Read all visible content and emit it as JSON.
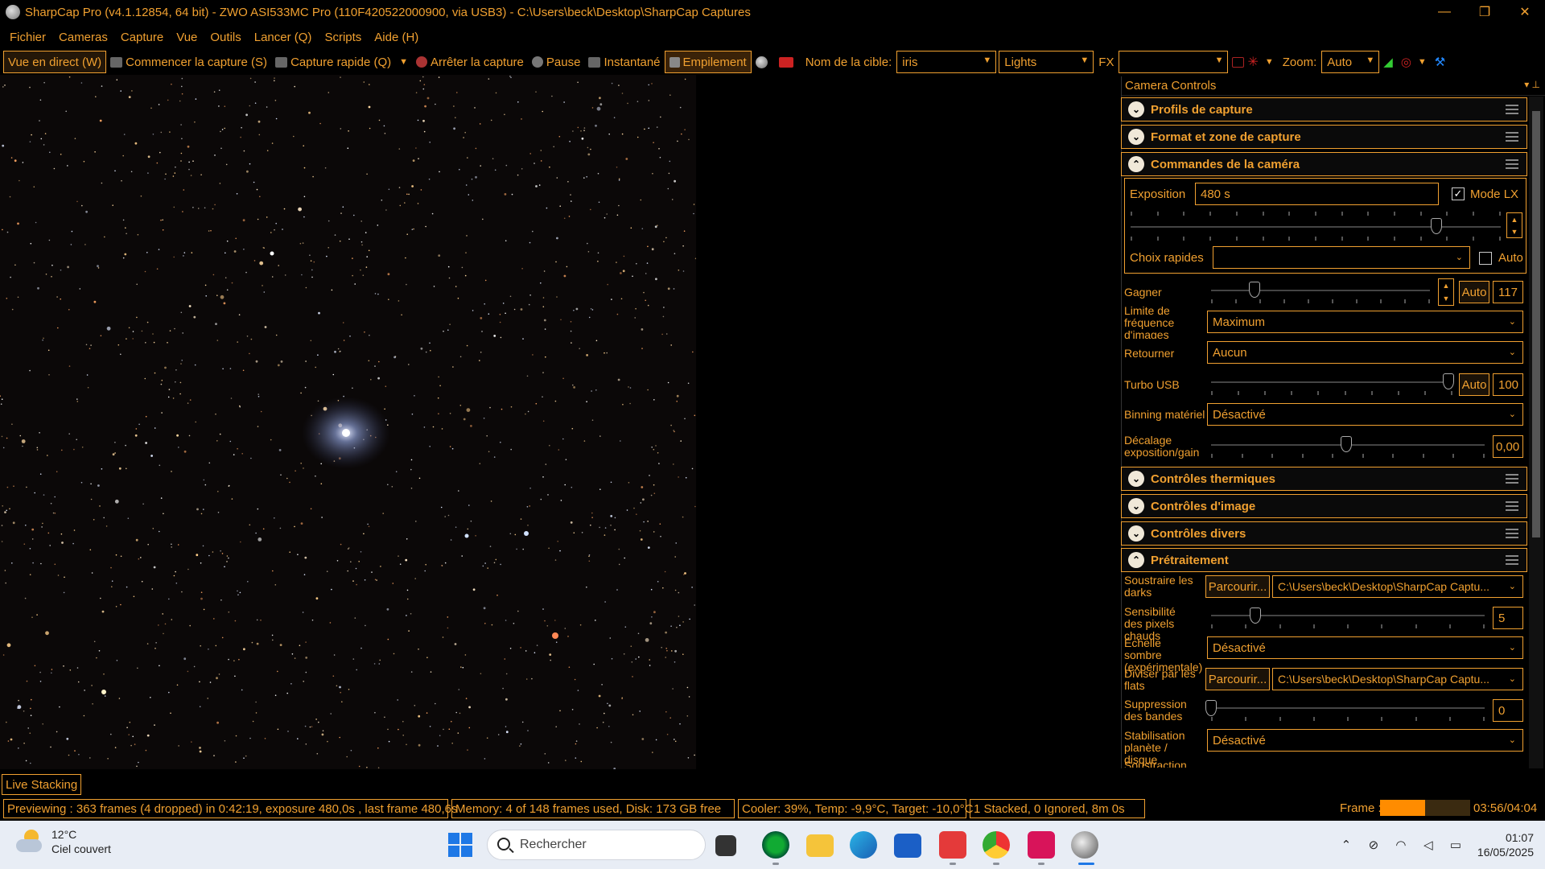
{
  "window": {
    "title": "SharpCap Pro (v4.1.12854, 64 bit) - ZWO ASI533MC Pro (110F420522000900, via USB3) - C:\\Users\\beck\\Desktop\\SharpCap Captures",
    "minimize": "—",
    "maximize": "❐",
    "close": "✕"
  },
  "menu": [
    "Fichier",
    "Cameras",
    "Capture",
    "Vue",
    "Outils",
    "Lancer (Q)",
    "Scripts",
    "Aide (H)"
  ],
  "toolbar": {
    "live_view": "Vue en direct (W)",
    "start_capture": "Commencer la capture (S)",
    "quick_capture": "Capture rapide (Q)",
    "stop_capture": "Arrêter la capture",
    "pause": "Pause",
    "snapshot": "Instantané",
    "stacking": "Empilement",
    "target_label": "Nom de la cible:",
    "target_value": "iris",
    "frame_type": "Lights",
    "fx_label": "FX",
    "fx_value": "",
    "zoom_label": "Zoom:",
    "zoom_value": "Auto"
  },
  "panel": {
    "header": "Camera Controls",
    "sections": {
      "profiles": "Profils de capture",
      "format": "Format et zone de capture",
      "camera": "Commandes de la caméra",
      "thermal": "Contrôles thermiques",
      "image": "Contrôles d'image",
      "misc": "Contrôles divers",
      "preprocessing": "Prétraitement"
    },
    "exposure_label": "Exposition",
    "exposure_value": "480 s",
    "lx_mode_label": "Mode LX",
    "lx_mode_checked": true,
    "quick_choices_label": "Choix rapides",
    "quick_choices_value": "",
    "quick_auto_label": "Auto",
    "gain_label": "Gagner",
    "gain_auto": "Auto",
    "gain_value": "117",
    "fps_limit_label": "Limite de fréquence d'images",
    "fps_limit_value": "Maximum",
    "flip_label": "Retourner",
    "flip_value": "Aucun",
    "usb_turbo_label": "Turbo USB",
    "usb_turbo_auto": "Auto",
    "usb_turbo_value": "100",
    "hw_binning_label": "Binning matériel",
    "hw_binning_value": "Désactivé",
    "exp_gain_offset_label": "Décalage exposition/gain",
    "exp_gain_offset_value": "0,00",
    "subtract_darks_label": "Soustraire les darks",
    "browse_label": "Parcourir...",
    "darks_path": "C:\\Users\\beck\\Desktop\\SharpCap Captu...",
    "hot_pixel_label": "Sensibilité des pixels chauds",
    "hot_pixel_value": "5",
    "dark_scale_label": "Échelle sombre (expérimentale)",
    "dark_scale_value": "Désactivé",
    "divide_flats_label": "Diviser par les flats",
    "flats_path": "C:\\Users\\beck\\Desktop\\SharpCap Captu...",
    "banding_label": "Suppression des bandes",
    "banding_value": "0",
    "stabilization_label": "Stabilisation planète / disque",
    "stabilization_value": "Désactivé",
    "bg_subtract_label": "Soustraction"
  },
  "live_stacking_tab": "Live Stacking",
  "status": {
    "previewing": "Previewing : 363 frames (4 dropped) in 0:42:19, exposure 480,0s , last frame 480,6s",
    "memory": "Memory: 4 of 148 frames used, Disk: 173 GB free",
    "cooler": "Cooler: 39%, Temp: -9,9°C, Target: -10,0°C",
    "stacked": "1 Stacked, 0 Ignored, 8m 0s",
    "frame_label": "Frame :",
    "frame_progress": 0.5,
    "frame_time": "03:56/04:04"
  },
  "taskbar": {
    "temperature": "12°C",
    "weather": "Ciel couvert",
    "search_placeholder": "Rechercher",
    "time": "01:07",
    "date": "16/05/2025"
  },
  "colors": {
    "accent": "#f0a030",
    "progress": "#ff8c00",
    "background": "#000000"
  }
}
